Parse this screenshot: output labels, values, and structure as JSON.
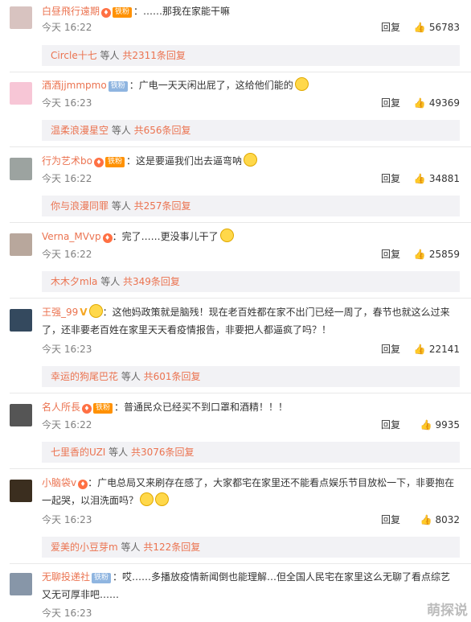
{
  "comments": [
    {
      "name": "白昼飛行遠期",
      "text": "：……那我在家能干嘛",
      "time": "今天 16:22",
      "reply": "回复",
      "likes": "56783",
      "sub_name": "Circle十七",
      "sub_mid": " 等人 ",
      "sub_count": "共2311条回复",
      "badges": [
        "铁粉"
      ]
    },
    {
      "name": "酒酒jjmmpmo",
      "text": "：广电一天天闲出屁了，这给他们能的",
      "time": "今天 16:23",
      "reply": "回复",
      "likes": "49369",
      "sub_name": "温柔浪漫星空",
      "sub_mid": " 等人 ",
      "sub_count": "共656条回复",
      "badges": [
        "铁粉"
      ]
    },
    {
      "name": "行为艺术bo",
      "text": "：这是要逼我们出去逼弯呐",
      "time": "今天 16:22",
      "reply": "回复",
      "likes": "34881",
      "sub_name": "你与浪漫同罪",
      "sub_mid": " 等人 ",
      "sub_count": "共257条回复",
      "badges": [
        "铁粉"
      ]
    },
    {
      "name": "Verna_MVvp",
      "text": "：完了……更没事儿干了",
      "time": "今天 16:22",
      "reply": "回复",
      "likes": "25859",
      "sub_name": "木木夕mla",
      "sub_mid": " 等人 ",
      "sub_count": "共349条回复"
    },
    {
      "name": "王强_99",
      "text": "：这他妈政策就是脑残！现在老百姓都在家不出门已经一周了，春节也就这么过来了，还非要老百姓在家里天天看疫情报告，非要把人都逼疯了吗？！",
      "time": "今天 16:23",
      "reply": "回复",
      "likes": "22141",
      "sub_name": "幸运的狗尾巴花",
      "sub_mid": " 等人 ",
      "sub_count": "共601条回复"
    },
    {
      "name": "名人所長",
      "text": "：普通民众已经买不到口罩和酒精！！！",
      "time": "今天 16:22",
      "reply": "回复",
      "likes": "9935",
      "sub_name": "七里香的UZI",
      "sub_mid": " 等人 ",
      "sub_count": "共3076条回复",
      "badges": [
        "铁粉"
      ]
    },
    {
      "name": "小脑袋v",
      "text": "：广电总局又来刷存在感了，大家都宅在家里还不能看点娱乐节目放松一下，非要抱在一起哭，以泪洗面吗？",
      "time": "今天 16:23",
      "reply": "回复",
      "likes": "8032",
      "sub_name": "爱美的小豆芽m",
      "sub_mid": " 等人 ",
      "sub_count": "共122条回复"
    },
    {
      "name": "无聊投递社",
      "text": "：哎……多播放疫情新闻倒也能理解…但全国人民宅在家里这么无聊了看点综艺又无可厚非吧……",
      "time": "今天 16:23",
      "reply": "",
      "likes": "",
      "badges": [
        "铁粉"
      ]
    }
  ],
  "watermark": "萌探说",
  "colors": {
    "username": "#eb7350",
    "iron_fan": "#ff9100",
    "sub_bg": "#f2f2f5"
  },
  "icons": {
    "like": "thumbs-up-icon",
    "vip": "vip-icon",
    "emoji": "emoji-icon"
  }
}
